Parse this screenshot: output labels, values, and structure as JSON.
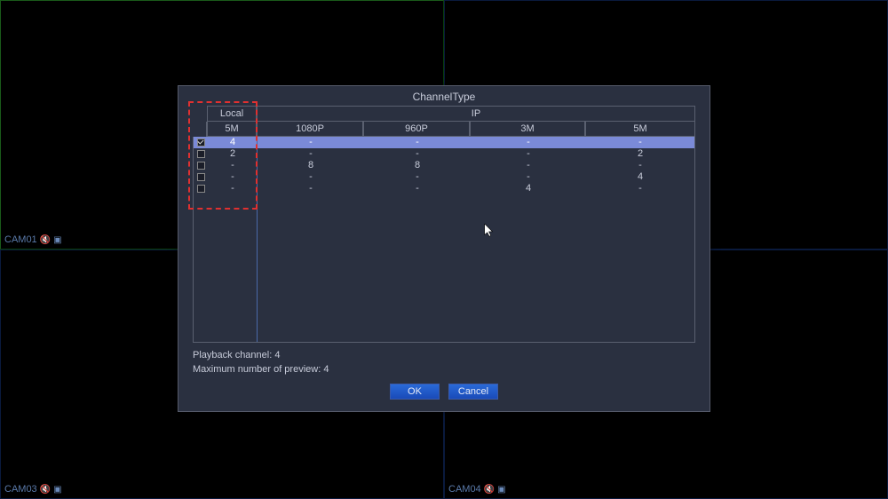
{
  "cameras": {
    "tl": "CAM01",
    "bl": "CAM03",
    "br": "CAM04"
  },
  "dialog": {
    "title": "ChannelType",
    "groups": {
      "local": "Local",
      "ip": "IP"
    },
    "headers": {
      "local_5m": "5M",
      "p1080": "1080P",
      "p960": "960P",
      "m3": "3M",
      "ip_5m": "5M"
    },
    "rows": [
      {
        "checked": true,
        "local_5m": "4",
        "p1080": "-",
        "p960": "-",
        "m3": "-",
        "ip_5m": "-"
      },
      {
        "checked": false,
        "local_5m": "2",
        "p1080": "-",
        "p960": "-",
        "m3": "-",
        "ip_5m": "2"
      },
      {
        "checked": false,
        "local_5m": "-",
        "p1080": "8",
        "p960": "8",
        "m3": "-",
        "ip_5m": "-"
      },
      {
        "checked": false,
        "local_5m": "-",
        "p1080": "-",
        "p960": "-",
        "m3": "-",
        "ip_5m": "4"
      },
      {
        "checked": false,
        "local_5m": "-",
        "p1080": "-",
        "p960": "-",
        "m3": "4",
        "ip_5m": "-"
      }
    ],
    "footer": {
      "playback": "Playback channel: 4",
      "preview": "Maximum number of preview: 4"
    },
    "buttons": {
      "ok": "OK",
      "cancel": "Cancel"
    }
  }
}
